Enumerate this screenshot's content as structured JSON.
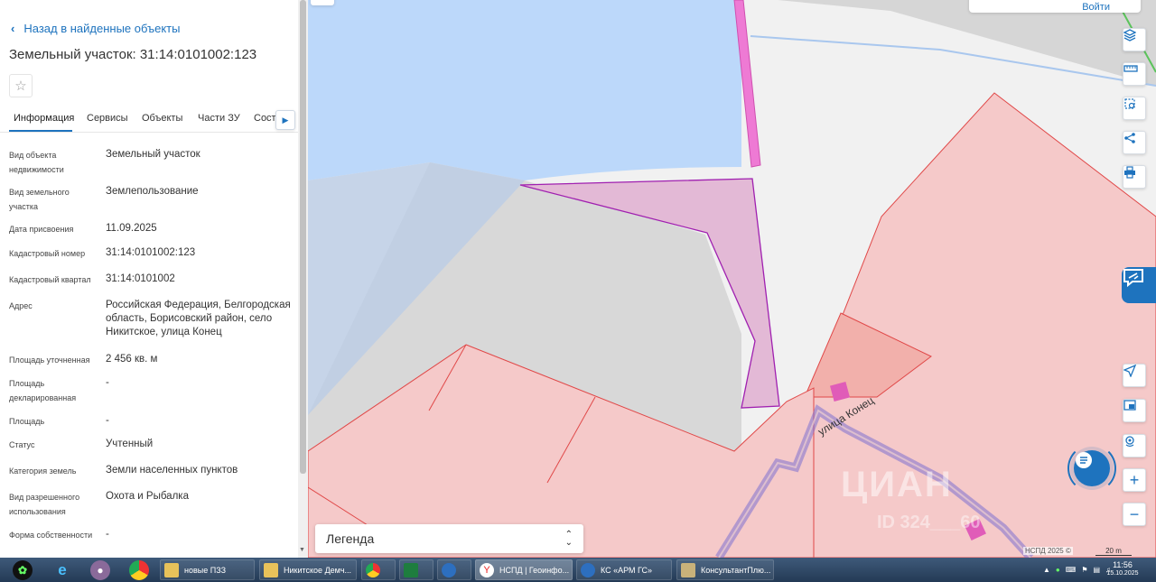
{
  "sidebar": {
    "back_label": "Назад в найденные объекты",
    "title": "Земельный участок: 31:14:0101002:123",
    "tabs": [
      "Информация",
      "Сервисы",
      "Объекты",
      "Части ЗУ",
      "Соста"
    ],
    "fields": [
      {
        "label": "Вид объекта недвижимости",
        "value": "Земельный участок"
      },
      {
        "label": "Вид земельного участка",
        "value": "Землепользование"
      },
      {
        "label": "Дата присвоения",
        "value": "11.09.2025"
      },
      {
        "label": "Кадастровый номер",
        "value": "31:14:0101002:123"
      },
      {
        "label": "Кадастровый квартал",
        "value": "31:14:0101002"
      },
      {
        "label": "Адрес",
        "value": "Российская Федерация, Белгородская область, Борисовский район, село Никитское, улица Конец"
      },
      {
        "label": "Площадь уточненная",
        "value": "2 456 кв. м"
      },
      {
        "label": "Площадь декларированная",
        "value": "-"
      },
      {
        "label": "Площадь",
        "value": "-"
      },
      {
        "label": "Статус",
        "value": "Учтенный"
      },
      {
        "label": "Категория земель",
        "value": "Земли населенных пунктов"
      },
      {
        "label": "Вид разрешенного использования",
        "value": "Охота и Рыбалка"
      },
      {
        "label": "Форма собственности",
        "value": "-"
      }
    ]
  },
  "map": {
    "login_label": "Войти",
    "street_label": "улица Конец",
    "legend_label": "Легенда",
    "copyright": "НСПД 2025 ©",
    "scale_label": "20 m",
    "watermark": "ЦИАН",
    "watermark_id": "ID 324___60",
    "colors": {
      "water": "#bcd8fa",
      "parcel_fill": "#f5c9c9",
      "parcel_stroke": "#e04848",
      "selected_fill": "#e3b9d6",
      "selected_stroke": "#a020b0",
      "accent": "#1e73be"
    },
    "controls": [
      "layers-icon",
      "ruler-icon",
      "select-area-icon",
      "share-icon",
      "print-icon",
      "locate-icon",
      "minimap-icon",
      "geo-pin-icon",
      "zoom-in-icon",
      "zoom-out-icon"
    ]
  },
  "taskbar": {
    "tasks": [
      {
        "label": "новые ПЗЗ"
      },
      {
        "label": "Никитское Демч..."
      },
      {
        "label": ""
      },
      {
        "label": ""
      },
      {
        "label": ""
      },
      {
        "label": "НСПД | Геоинфо..."
      },
      {
        "label": "КС «АРМ ГС»"
      },
      {
        "label": "КонсультантПлю..."
      }
    ],
    "time": "11:56",
    "date": "15.10.2025"
  }
}
